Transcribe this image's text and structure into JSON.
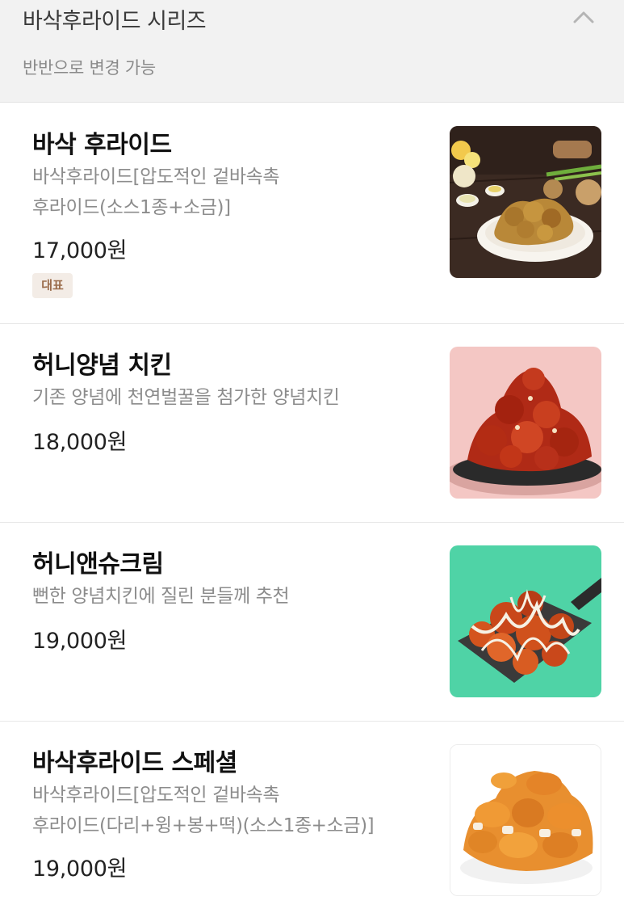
{
  "section": {
    "title": "바삭후라이드 시리즈",
    "subtitle": "반반으로 변경 가능",
    "collapse_icon": "chevron-up-icon"
  },
  "items": [
    {
      "name": "바삭 후라이드",
      "desc_lines": [
        "바삭후라이드[압도적인 겉바속촉",
        "후라이드(소스1종+소금)]"
      ],
      "price": "17,000원",
      "badge": "대표",
      "image": "fried-chicken-platter-image"
    },
    {
      "name": "허니양념 치킨",
      "desc_lines": [
        "기존 양념에 천연벌꿀을 첨가한 양념치킨"
      ],
      "price": "18,000원",
      "image": "honey-seasoned-chicken-image"
    },
    {
      "name": "허니앤슈크림",
      "desc_lines": [
        "뻔한 양념치킨에 질린 분들께 추천"
      ],
      "price": "19,000원",
      "image": "honey-cream-chicken-image"
    },
    {
      "name": "바삭후라이드 스페셜",
      "desc_lines": [
        "바삭후라이드[압도적인 겉바속촉",
        "후라이드(다리+윙+봉+떡)(소스1종+소금)]"
      ],
      "price": "19,000원",
      "image": "fried-chicken-special-image"
    }
  ],
  "colors": {
    "header_bg": "#f2f2f2",
    "badge_bg": "#f3ece6",
    "badge_text": "#9a6b4a"
  }
}
